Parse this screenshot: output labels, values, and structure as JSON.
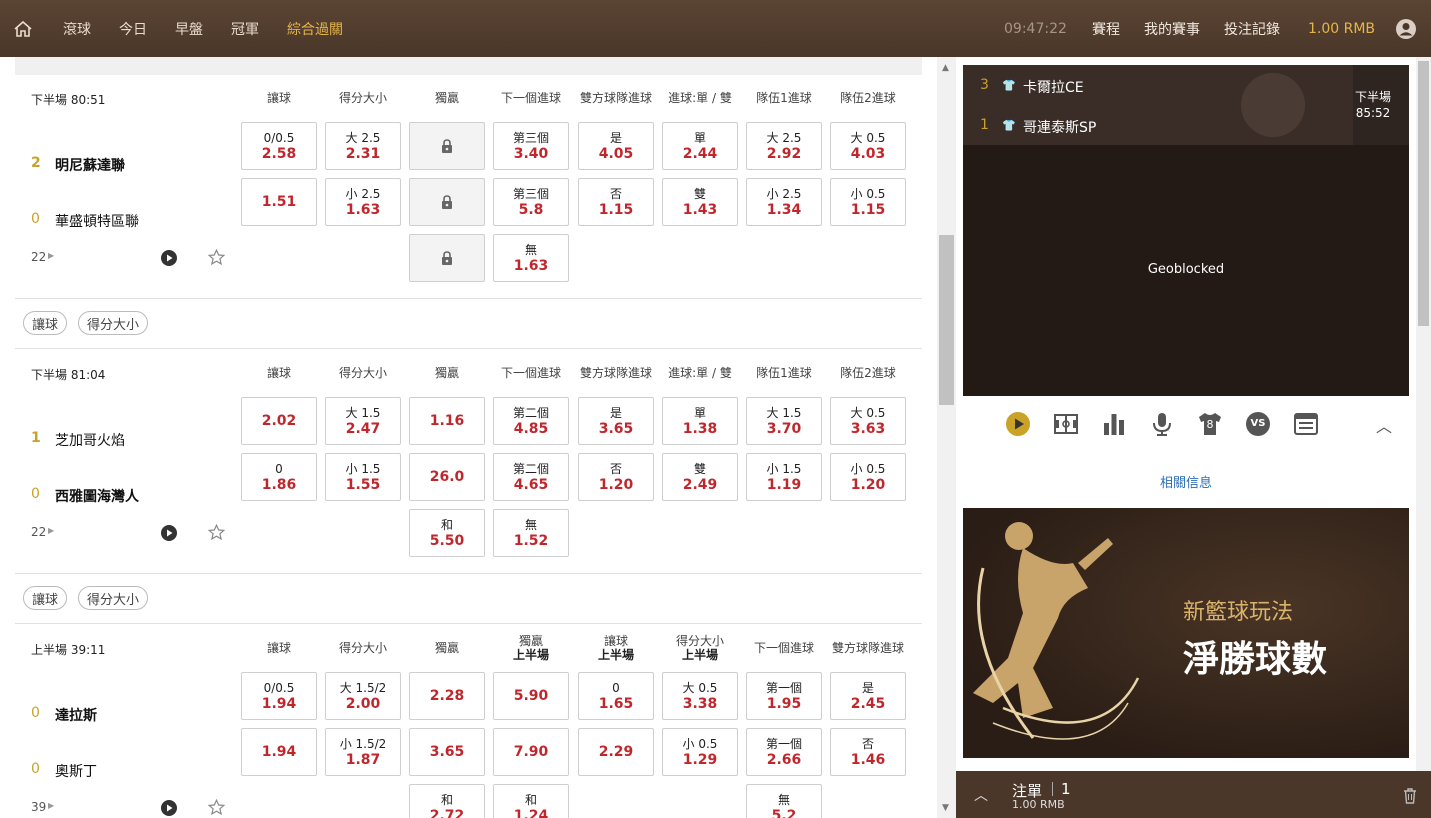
{
  "nav": {
    "items": [
      "滾球",
      "今日",
      "早盤",
      "冠軍",
      "綜合過關"
    ],
    "active_index": 4,
    "time": "09:47:22",
    "schedule": "賽程",
    "my_events": "我的賽事",
    "bet_records": "投注記錄",
    "balance": "1.00 RMB"
  },
  "matches": [
    {
      "period": "下半場  80:51",
      "headers": [
        "讓球",
        "得分大小",
        "獨贏",
        "下一個進球",
        "雙方球隊進球",
        "進球:單 / 雙",
        "隊伍1進球",
        "隊伍2進球"
      ],
      "headers2": [
        "",
        "",
        "",
        "",
        "",
        "",
        "",
        ""
      ],
      "team1": {
        "score": "2",
        "name": "明尼蘇達聯",
        "bold": true
      },
      "team2": {
        "score": "0",
        "name": "華盛頓特區聯",
        "bold": false
      },
      "count": "22",
      "row1": [
        [
          "0/0.5",
          "2.58"
        ],
        [
          "大 2.5",
          "2.31"
        ],
        [
          "lock",
          ""
        ],
        [
          "第三個",
          "3.40"
        ],
        [
          "是",
          "4.05"
        ],
        [
          "單",
          "2.44"
        ],
        [
          "大 2.5",
          "2.92"
        ],
        [
          "大 0.5",
          "4.03"
        ]
      ],
      "row2": [
        [
          "",
          "1.51"
        ],
        [
          "小 2.5",
          "1.63"
        ],
        [
          "lock",
          ""
        ],
        [
          "第三個",
          "5.8"
        ],
        [
          "否",
          "1.15"
        ],
        [
          "雙",
          "1.43"
        ],
        [
          "小 2.5",
          "1.34"
        ],
        [
          "小 0.5",
          "1.15"
        ]
      ],
      "row3": [
        null,
        null,
        [
          "lock",
          ""
        ],
        [
          "無",
          "1.63"
        ],
        null,
        null,
        null,
        null
      ]
    },
    {
      "period": "下半場  81:04",
      "headers": [
        "讓球",
        "得分大小",
        "獨贏",
        "下一個進球",
        "雙方球隊進球",
        "進球:單 / 雙",
        "隊伍1進球",
        "隊伍2進球"
      ],
      "headers2": [
        "",
        "",
        "",
        "",
        "",
        "",
        "",
        ""
      ],
      "team1": {
        "score": "1",
        "name": "芝加哥火焰",
        "bold": false
      },
      "team2": {
        "score": "0",
        "name": "西雅圖海灣人",
        "bold": true
      },
      "count": "22",
      "row1": [
        [
          "",
          "2.02"
        ],
        [
          "大 1.5",
          "2.47"
        ],
        [
          "",
          "1.16"
        ],
        [
          "第二個",
          "4.85"
        ],
        [
          "是",
          "3.65"
        ],
        [
          "單",
          "1.38"
        ],
        [
          "大 1.5",
          "3.70"
        ],
        [
          "大 0.5",
          "3.63"
        ]
      ],
      "row2": [
        [
          "0",
          "1.86"
        ],
        [
          "小 1.5",
          "1.55"
        ],
        [
          "",
          "26.0"
        ],
        [
          "第二個",
          "4.65"
        ],
        [
          "否",
          "1.20"
        ],
        [
          "雙",
          "2.49"
        ],
        [
          "小 1.5",
          "1.19"
        ],
        [
          "小 0.5",
          "1.20"
        ]
      ],
      "row3": [
        null,
        null,
        [
          "和",
          "5.50"
        ],
        [
          "無",
          "1.52"
        ],
        null,
        null,
        null,
        null
      ]
    },
    {
      "period": "上半場  39:11",
      "headers": [
        "讓球",
        "得分大小",
        "獨贏",
        "獨贏",
        "讓球",
        "得分大小",
        "下一個進球",
        "雙方球隊進球"
      ],
      "headers2": [
        "",
        "",
        "",
        "上半場",
        "上半場",
        "上半場",
        "",
        ""
      ],
      "team1": {
        "score": "0",
        "name": "達拉斯",
        "bold": true
      },
      "team2": {
        "score": "0",
        "name": "奧斯丁",
        "bold": false
      },
      "count": "39",
      "row1": [
        [
          "0/0.5",
          "1.94"
        ],
        [
          "大 1.5/2",
          "2.00"
        ],
        [
          "",
          "2.28"
        ],
        [
          "",
          "5.90"
        ],
        [
          "0",
          "1.65"
        ],
        [
          "大 0.5",
          "3.38"
        ],
        [
          "第一個",
          "1.95"
        ],
        [
          "是",
          "2.45"
        ]
      ],
      "row2": [
        [
          "",
          "1.94"
        ],
        [
          "小 1.5/2",
          "1.87"
        ],
        [
          "",
          "3.65"
        ],
        [
          "",
          "7.90"
        ],
        [
          "",
          "2.29"
        ],
        [
          "小 0.5",
          "1.29"
        ],
        [
          "第一個",
          "2.66"
        ],
        [
          "否",
          "1.46"
        ]
      ],
      "row3": [
        null,
        null,
        [
          "和",
          "2.72"
        ],
        [
          "和",
          "1.24"
        ],
        null,
        null,
        [
          "無",
          "5.2"
        ],
        null
      ]
    }
  ],
  "pills": [
    "讓球",
    "得分大小"
  ],
  "live": {
    "team1_score": "3",
    "team1_name": "卡爾拉CE",
    "team2_score": "1",
    "team2_name": "哥連泰斯SP",
    "period": "下半場",
    "clock": "85:52",
    "geoblocked": "Geoblocked",
    "shirt_number": "8",
    "vs": "VS"
  },
  "related": "相關信息",
  "banner": {
    "line1": "新籃球玩法",
    "line2": "淨勝球數"
  },
  "betslip": {
    "label": "注單",
    "count": "1",
    "amount": "1.00 RMB"
  },
  "colors": {
    "header_bg": "#4a3729",
    "accent": "#c9a227",
    "odds": "#c0272d"
  }
}
